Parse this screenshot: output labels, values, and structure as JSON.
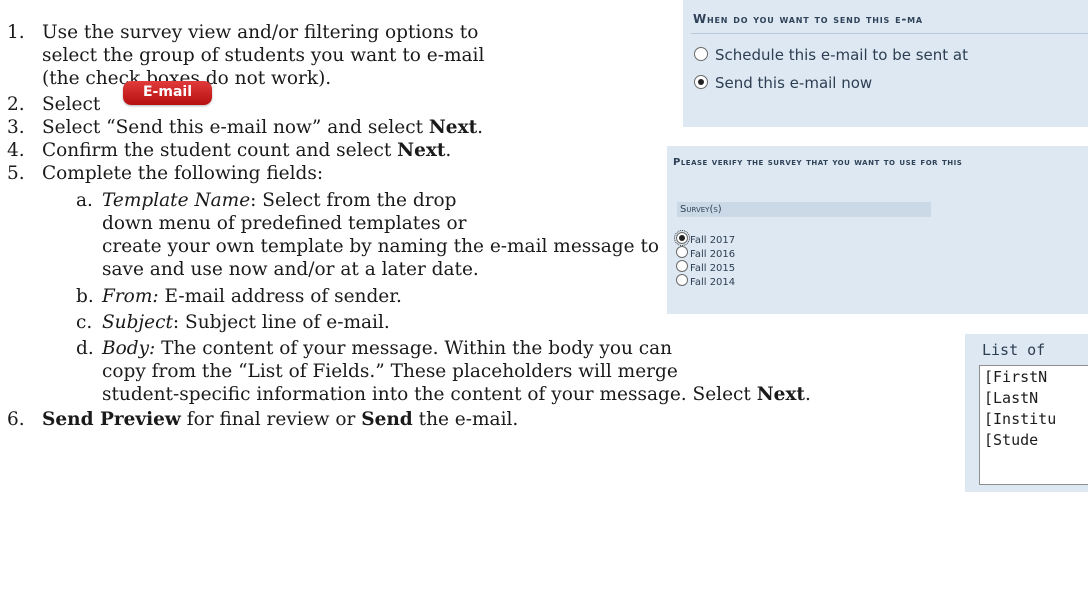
{
  "steps": [
    {
      "num": "1.",
      "lines": [
        "Use the survey view and/or filtering options to",
        "select the group of students you want to e-mail",
        "(the check boxes do not work)."
      ]
    },
    {
      "num": "2.",
      "text": "Select"
    },
    {
      "num": "3.",
      "pre": "Select “Send this e-mail now” and select ",
      "bold": "Next",
      "post": "."
    },
    {
      "num": "4.",
      "pre": "Confirm the student count and select ",
      "bold": "Next",
      "post": "."
    },
    {
      "num": "5.",
      "text": "Complete the following fields:"
    },
    {
      "num": "6.",
      "b1": "Send Preview",
      "mid": " for final review or ",
      "b2": "Send",
      "post": " the e-mail."
    }
  ],
  "substeps": [
    {
      "letter": "a.",
      "label": "Template Name",
      "lines": [
        ": Select from the drop",
        "down menu of predefined templates or",
        "create your own template by naming the e-mail message to",
        "save and use now and/or at a later date."
      ]
    },
    {
      "letter": "b.",
      "label": "From:",
      "text": " E-mail address of sender."
    },
    {
      "letter": "c.",
      "label": "Subject",
      "text": ": Subject line of e-mail."
    },
    {
      "letter": "d.",
      "label": "Body:",
      "lines": [
        " The content of your message. Within the body you can",
        "copy from the “List of Fields.” These placeholders will merge",
        "student-specific information into the content of your message. Select "
      ],
      "bold": "Next",
      "post": "."
    }
  ],
  "email_button": {
    "label": "E-mail",
    "color": "#c81e1e"
  },
  "send_panel": {
    "heading": "When do you want to send this e-ma",
    "options": [
      {
        "label": "Schedule this e-mail to be sent at",
        "selected": false
      },
      {
        "label": "Send this e-mail now",
        "selected": true
      }
    ]
  },
  "survey_panel": {
    "heading": "Please verify the survey that you want to use for this",
    "column_header": "Survey(s)",
    "surveys": [
      {
        "label": "Fall 2017",
        "selected": true
      },
      {
        "label": "Fall 2016",
        "selected": false
      },
      {
        "label": "Fall 2015",
        "selected": false
      },
      {
        "label": "Fall 2014",
        "selected": false
      }
    ]
  },
  "fields_panel": {
    "title": "List of",
    "fields": [
      "[FirstN",
      "[LastN",
      "[Institu",
      "[Stude"
    ]
  },
  "colors": {
    "panel_bg": "#dde8f2",
    "text": "#1a1a1a"
  }
}
